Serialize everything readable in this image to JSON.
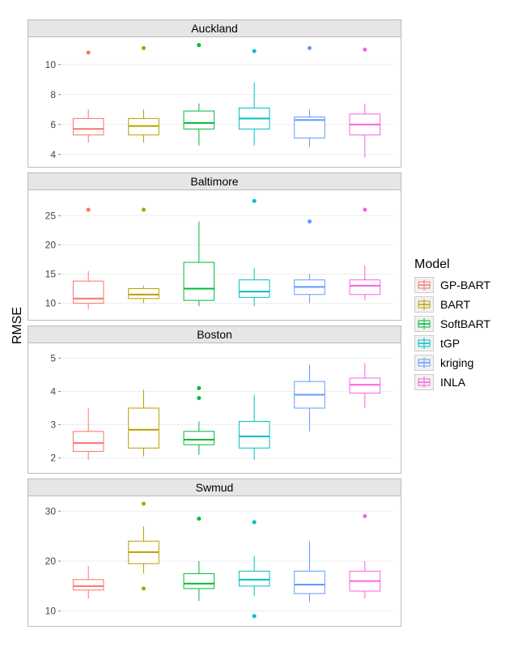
{
  "ylabel": "RMSE",
  "legend": {
    "title": "Model",
    "items": [
      {
        "name": "GP-BART",
        "color": "#F8766D"
      },
      {
        "name": "BART",
        "color": "#B79F00"
      },
      {
        "name": "SoftBART",
        "color": "#00BA38"
      },
      {
        "name": "tGP",
        "color": "#00BFC4"
      },
      {
        "name": "kriging",
        "color": "#619CFF"
      },
      {
        "name": "INLA",
        "color": "#F564E3"
      }
    ]
  },
  "facets": [
    "Auckland",
    "Baltimore",
    "Boston",
    "Swmud"
  ],
  "chart_data": [
    {
      "facet": "Auckland",
      "ylim": [
        3.5,
        11.5
      ],
      "ticks": [
        4,
        6,
        8,
        10
      ],
      "series": [
        {
          "name": "GP-BART",
          "ymin": 4.8,
          "q1": 5.3,
          "median": 5.7,
          "q3": 6.4,
          "ymax": 7.0,
          "outliers": [
            10.8
          ]
        },
        {
          "name": "BART",
          "ymin": 4.8,
          "q1": 5.3,
          "median": 5.9,
          "q3": 6.4,
          "ymax": 7.0,
          "outliers": [
            11.1
          ]
        },
        {
          "name": "SoftBART",
          "ymin": 4.6,
          "q1": 5.7,
          "median": 6.1,
          "q3": 6.9,
          "ymax": 7.4,
          "outliers": [
            11.3
          ]
        },
        {
          "name": "tGP",
          "ymin": 4.6,
          "q1": 5.7,
          "median": 6.4,
          "q3": 7.1,
          "ymax": 8.8,
          "outliers": [
            10.9
          ]
        },
        {
          "name": "kriging",
          "ymin": 4.5,
          "q1": 5.1,
          "median": 6.3,
          "q3": 6.5,
          "ymax": 7.0,
          "outliers": [
            11.1
          ]
        },
        {
          "name": "INLA",
          "ymin": 3.8,
          "q1": 5.3,
          "median": 6.0,
          "q3": 6.7,
          "ymax": 7.4,
          "outliers": [
            11.0
          ]
        }
      ]
    },
    {
      "facet": "Baltimore",
      "ylim": [
        8,
        28.5
      ],
      "ticks": [
        10,
        15,
        20,
        25
      ],
      "series": [
        {
          "name": "GP-BART",
          "ymin": 9.0,
          "q1": 10.0,
          "median": 10.8,
          "q3": 13.8,
          "ymax": 15.5,
          "outliers": [
            26.0
          ]
        },
        {
          "name": "BART",
          "ymin": 10.0,
          "q1": 10.8,
          "median": 11.5,
          "q3": 12.5,
          "ymax": 13.0,
          "outliers": [
            26.0
          ]
        },
        {
          "name": "SoftBART",
          "ymin": 9.5,
          "q1": 10.5,
          "median": 12.5,
          "q3": 17.0,
          "ymax": 24.0,
          "outliers": []
        },
        {
          "name": "tGP",
          "ymin": 9.5,
          "q1": 11.0,
          "median": 12.0,
          "q3": 14.0,
          "ymax": 16.0,
          "outliers": [
            27.5
          ]
        },
        {
          "name": "kriging",
          "ymin": 10.0,
          "q1": 11.5,
          "median": 12.8,
          "q3": 14.0,
          "ymax": 15.0,
          "outliers": [
            24.0
          ]
        },
        {
          "name": "INLA",
          "ymin": 10.5,
          "q1": 11.5,
          "median": 13.0,
          "q3": 14.0,
          "ymax": 16.5,
          "outliers": [
            26.0
          ]
        }
      ]
    },
    {
      "facet": "Boston",
      "ylim": [
        1.7,
        5.3
      ],
      "ticks": [
        2,
        3,
        4,
        5
      ],
      "series": [
        {
          "name": "GP-BART",
          "ymin": 1.95,
          "q1": 2.2,
          "median": 2.45,
          "q3": 2.8,
          "ymax": 3.5,
          "outliers": []
        },
        {
          "name": "BART",
          "ymin": 2.05,
          "q1": 2.3,
          "median": 2.85,
          "q3": 3.5,
          "ymax": 4.05,
          "outliers": []
        },
        {
          "name": "SoftBART",
          "ymin": 2.1,
          "q1": 2.4,
          "median": 2.55,
          "q3": 2.8,
          "ymax": 3.1,
          "outliers": [
            3.8,
            4.1
          ]
        },
        {
          "name": "tGP",
          "ymin": 1.95,
          "q1": 2.3,
          "median": 2.65,
          "q3": 3.1,
          "ymax": 3.9,
          "outliers": []
        },
        {
          "name": "kriging",
          "ymin": 2.8,
          "q1": 3.5,
          "median": 3.9,
          "q3": 4.3,
          "ymax": 4.8,
          "outliers": []
        },
        {
          "name": "INLA",
          "ymin": 3.5,
          "q1": 3.95,
          "median": 4.2,
          "q3": 4.4,
          "ymax": 4.85,
          "outliers": []
        }
      ]
    },
    {
      "facet": "Swmud",
      "ylim": [
        8,
        32
      ],
      "ticks": [
        10,
        20,
        30
      ],
      "series": [
        {
          "name": "GP-BART",
          "ymin": 12.5,
          "q1": 14.2,
          "median": 15.0,
          "q3": 16.3,
          "ymax": 19.0,
          "outliers": []
        },
        {
          "name": "BART",
          "ymin": 17.5,
          "q1": 19.5,
          "median": 21.8,
          "q3": 24.0,
          "ymax": 27.0,
          "outliers": [
            14.5,
            31.5
          ]
        },
        {
          "name": "SoftBART",
          "ymin": 12.0,
          "q1": 14.5,
          "median": 15.5,
          "q3": 17.5,
          "ymax": 20.0,
          "outliers": [
            28.5
          ]
        },
        {
          "name": "tGP",
          "ymin": 13.0,
          "q1": 15.0,
          "median": 16.3,
          "q3": 18.0,
          "ymax": 21.0,
          "outliers": [
            9.0,
            27.8
          ]
        },
        {
          "name": "kriging",
          "ymin": 11.8,
          "q1": 13.5,
          "median": 15.3,
          "q3": 18.0,
          "ymax": 24.0,
          "outliers": []
        },
        {
          "name": "INLA",
          "ymin": 12.5,
          "q1": 14.0,
          "median": 16.0,
          "q3": 18.0,
          "ymax": 20.0,
          "outliers": [
            29.0
          ]
        }
      ]
    }
  ]
}
